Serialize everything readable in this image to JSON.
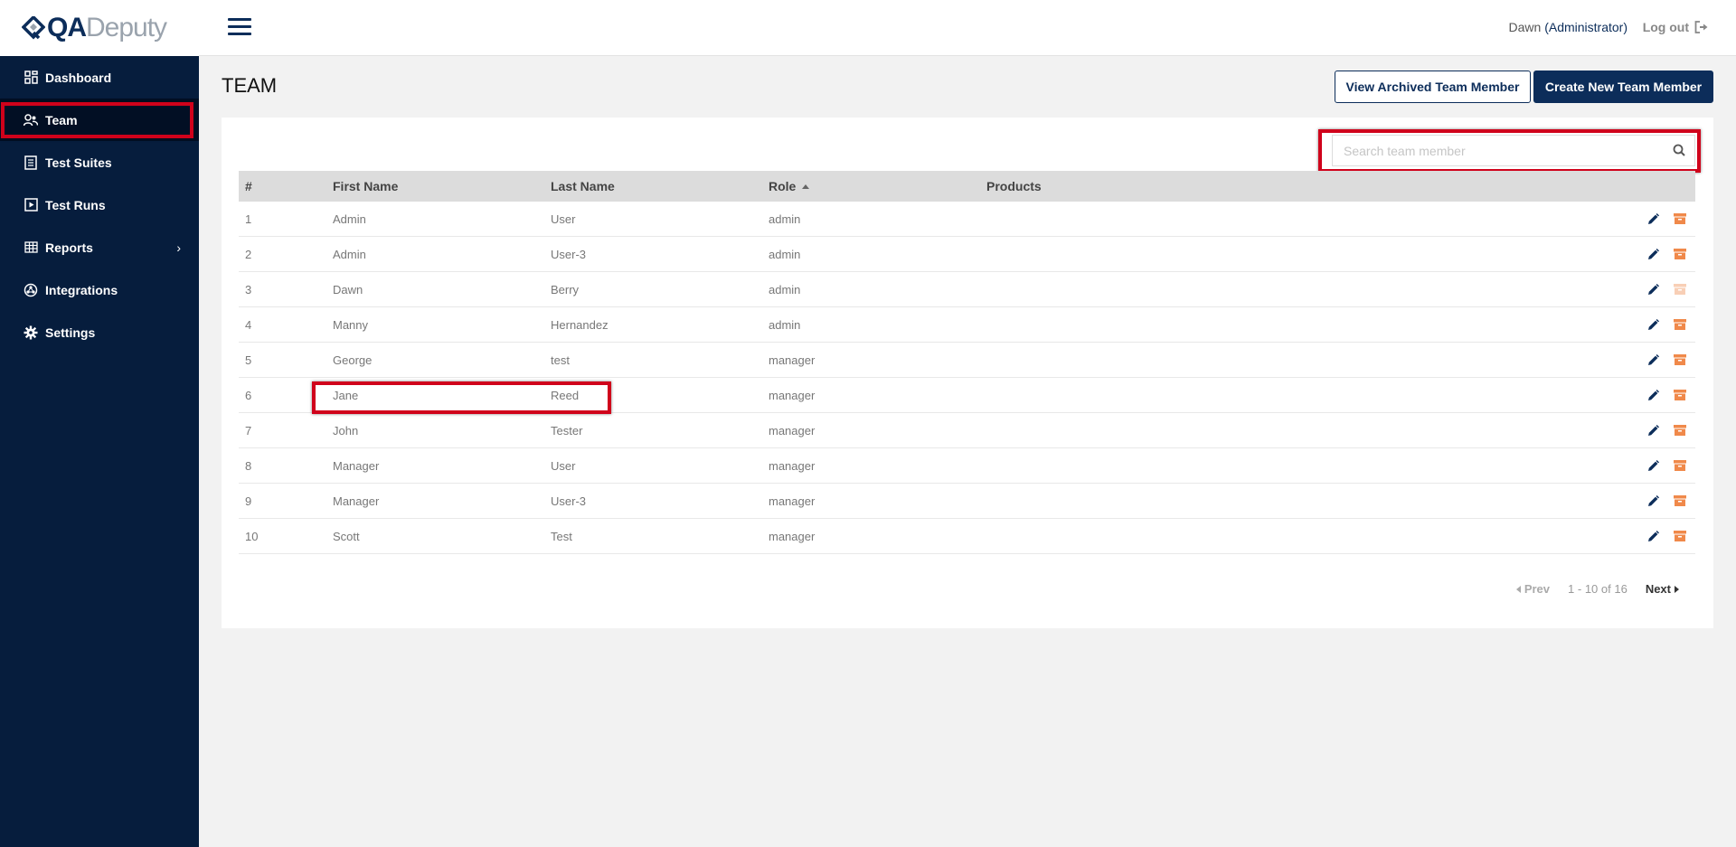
{
  "brand": {
    "logo_bold": "QA",
    "logo_light": "Deputy"
  },
  "sidebar": {
    "items": [
      {
        "label": "Dashboard",
        "icon": "dashboard-icon"
      },
      {
        "label": "Team",
        "icon": "team-icon",
        "active": true
      },
      {
        "label": "Test Suites",
        "icon": "test-suites-icon"
      },
      {
        "label": "Test Runs",
        "icon": "test-runs-icon"
      },
      {
        "label": "Reports",
        "icon": "reports-icon",
        "chevron": "›"
      },
      {
        "label": "Integrations",
        "icon": "integrations-icon"
      },
      {
        "label": "Settings",
        "icon": "settings-icon"
      }
    ]
  },
  "topbar": {
    "user_name": "Dawn",
    "user_role": "(Administrator)",
    "logout_label": "Log out"
  },
  "page": {
    "title": "TEAM",
    "view_archived_label": "View Archived Team Member",
    "create_new_label": "Create New Team Member"
  },
  "search": {
    "placeholder": "Search team member",
    "value": ""
  },
  "table": {
    "headers": {
      "num": "#",
      "first": "First Name",
      "last": "Last Name",
      "role": "Role",
      "products": "Products"
    },
    "sort": {
      "column": "Role",
      "direction": "ascending"
    },
    "rows": [
      {
        "num": "1",
        "first": "Admin",
        "last": "User",
        "role": "admin",
        "products": ""
      },
      {
        "num": "2",
        "first": "Admin",
        "last": "User-3",
        "role": "admin",
        "products": ""
      },
      {
        "num": "3",
        "first": "Dawn",
        "last": "Berry",
        "role": "admin",
        "products": "",
        "archive_disabled": true
      },
      {
        "num": "4",
        "first": "Manny",
        "last": "Hernandez",
        "role": "admin",
        "products": ""
      },
      {
        "num": "5",
        "first": "George",
        "last": "test",
        "role": "manager",
        "products": ""
      },
      {
        "num": "6",
        "first": "Jane",
        "last": "Reed",
        "role": "manager",
        "products": ""
      },
      {
        "num": "7",
        "first": "John",
        "last": "Tester",
        "role": "manager",
        "products": ""
      },
      {
        "num": "8",
        "first": "Manager",
        "last": "User",
        "role": "manager",
        "products": ""
      },
      {
        "num": "9",
        "first": "Manager",
        "last": "User-3",
        "role": "manager",
        "products": ""
      },
      {
        "num": "10",
        "first": "Scott",
        "last": "Test",
        "role": "manager",
        "products": ""
      }
    ]
  },
  "pagination": {
    "prev_label": "Prev",
    "range": "1 - 10 of 16",
    "next_label": "Next"
  },
  "colors": {
    "sidebar_bg": "#061d3d",
    "primary": "#0c2d5a",
    "edit_icon": "#0c2d5a",
    "archive_icon": "#f0894a",
    "highlight": "#d0021b"
  }
}
